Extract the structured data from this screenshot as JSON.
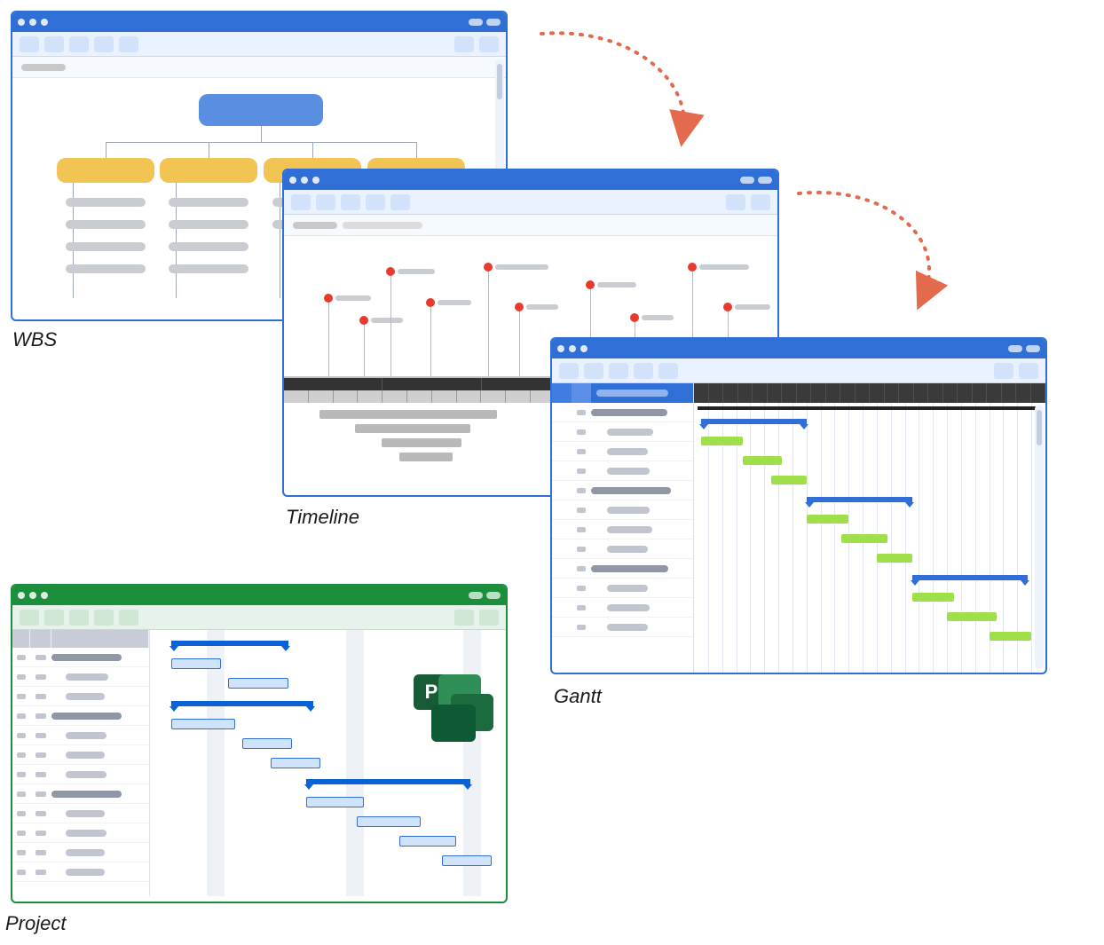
{
  "labels": {
    "wbs": "WBS",
    "timeline": "Timeline",
    "gantt": "Gantt",
    "project": "Project"
  },
  "concept": "Diagram showing four related project-planning views (WBS, Timeline, Gantt, MS Project) as stylized app windows connected by arrows",
  "colors": {
    "blue_frame": "#2f6fd6",
    "green_frame": "#1b8f3b",
    "wbs_root": "#5a8ee0",
    "wbs_child": "#f1c454",
    "timeline_dot": "#e93a2e",
    "gantt_task": "#9fe04a",
    "arrow": "#e46a4d"
  },
  "windows": {
    "wbs": {
      "frame_color": "blue",
      "children_count": 4,
      "sub_items_per_child": [
        4,
        4,
        4,
        4
      ]
    },
    "timeline": {
      "frame_color": "blue",
      "milestones": 10,
      "sub_gantt_rows": 4
    },
    "gantt": {
      "frame_color": "blue",
      "task_rows": 12,
      "group_rows": [
        1,
        5,
        9
      ],
      "summary_bars": 3
    },
    "project": {
      "frame_color": "green",
      "logo_letter": "P",
      "task_rows": 12,
      "group_rows": [
        1,
        4,
        8
      ],
      "summary_bars": 3
    }
  }
}
